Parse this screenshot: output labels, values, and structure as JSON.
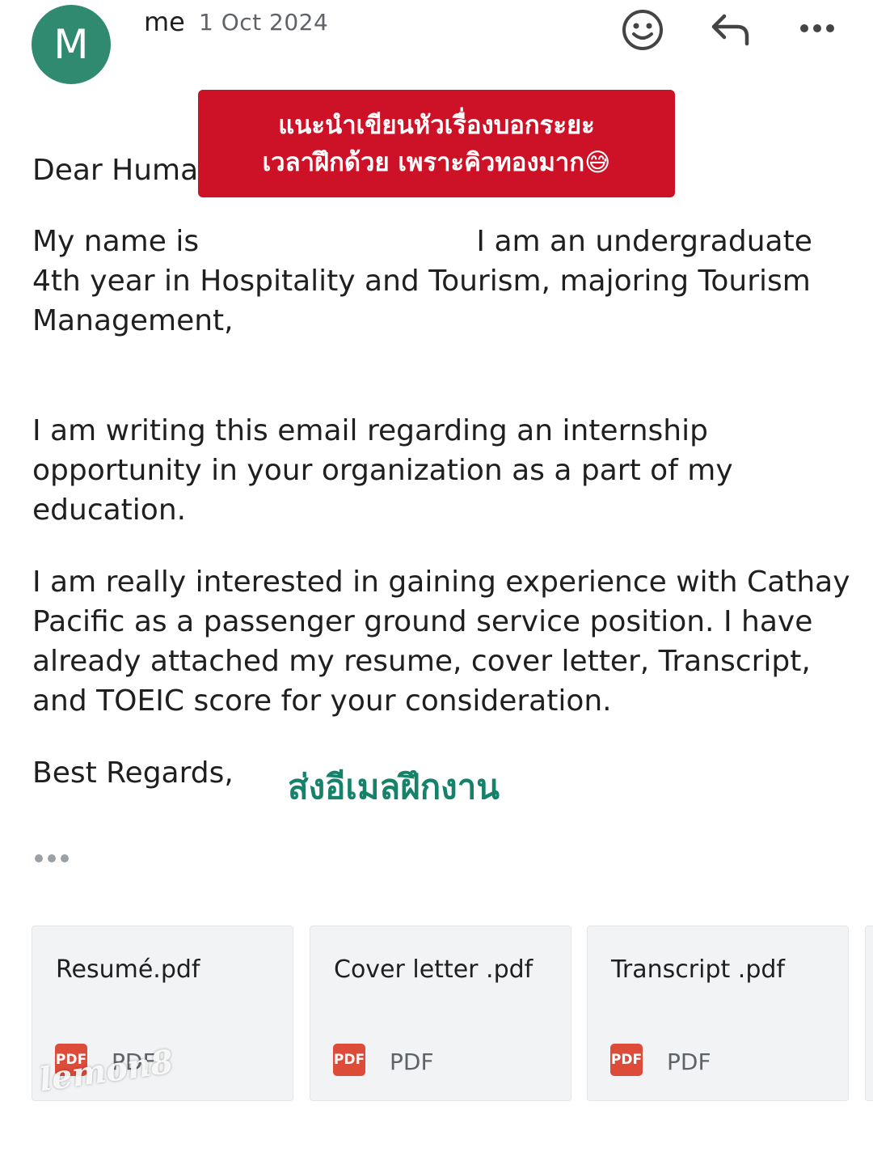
{
  "header": {
    "avatar_letter": "M",
    "avatar_color": "#2f8a70",
    "sender": "me",
    "date": "1 Oct 2024",
    "icons": [
      "emoji-icon",
      "reply-icon",
      "more-icon"
    ]
  },
  "overlay": {
    "line1": "แนะนำเขียนหัวเรื่องบอกระยะ",
    "line2": "เวลาฝึกด้วย เพราะคิวทองมาก😅",
    "color": "#cd1227"
  },
  "email": {
    "greeting": "Dear Huma",
    "para1": [
      "My name is                              I am an undergraduate",
      "4th year in Hospitality and Tourism, majoring Tourism",
      "Management,"
    ],
    "para2": [
      "I am writing this email regarding an internship",
      "opportunity in your organization as a part of my",
      "education."
    ],
    "para3": [
      "I am really interested in gaining experience with Cathay",
      "Pacific as a passenger ground service position. I have",
      "already attached my resume, cover letter, Transcript,",
      "and TOEIC score for your consideration."
    ],
    "closing": "Best Regards,",
    "thai_caption": "ส่งอีเมลฝึกงาน"
  },
  "attachments": [
    {
      "name": "Resumé.pdf",
      "badge": "PDF",
      "type": "PDF"
    },
    {
      "name": "Cover letter .pdf",
      "badge": "PDF",
      "type": "PDF"
    },
    {
      "name": "Transcript .pdf",
      "badge": "PDF",
      "type": "PDF"
    }
  ],
  "watermark": "lemon8"
}
